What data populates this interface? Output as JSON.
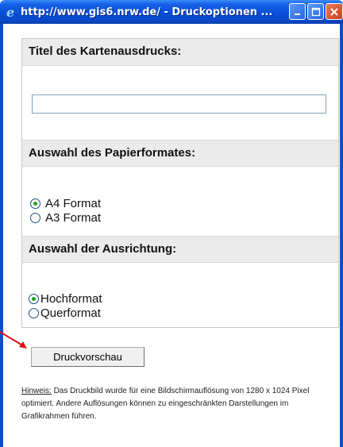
{
  "window": {
    "title": "http://www.gis6.nrw.de/ - Druckoptionen ...",
    "accent_color": "#0b4fd0",
    "buttons": {
      "minimize_icon": "minimize-icon",
      "maximize_icon": "maximize-icon",
      "close_icon": "close-icon"
    }
  },
  "form": {
    "title_section": {
      "heading": "Titel des Kartenausdrucks:",
      "input_value": "",
      "input_placeholder": ""
    },
    "paper_section": {
      "heading": "Auswahl des Papierformates:",
      "options": [
        {
          "label": "A4 Format",
          "checked": true
        },
        {
          "label": "A3 Format",
          "checked": false
        }
      ]
    },
    "orientation_section": {
      "heading": "Auswahl der Ausrichtung:",
      "options": [
        {
          "label": "Hochformat",
          "checked": true
        },
        {
          "label": "Querformat",
          "checked": false
        }
      ]
    }
  },
  "preview_button_label": "Druckvorschau",
  "hint": {
    "label": "Hinweis:",
    "text": " Das Druckbild wurde für eine Bildschirmauflösung von 1280 x 1024 Pixel optimiert. Andere Auflösungen können zu eingeschränkten Darstellungen im Grafikrahmen führen."
  }
}
